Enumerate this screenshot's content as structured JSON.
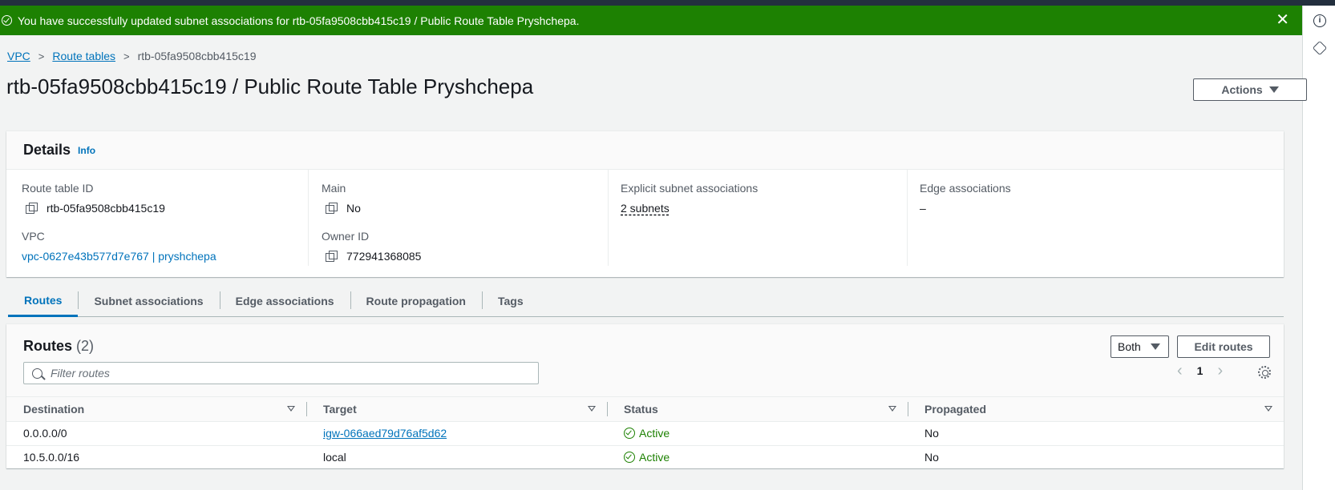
{
  "flash": {
    "message": "You have successfully updated subnet associations for rtb-05fa9508cbb415c19 / Public Route Table Pryshchepa.",
    "close": "✕"
  },
  "breadcrumb": [
    "VPC",
    "Route tables",
    "rtb-05fa9508cbb415c19"
  ],
  "page_title": "rtb-05fa9508cbb415c19 / Public Route Table Pryshchepa",
  "actions_label": "Actions",
  "details": {
    "heading": "Details",
    "info": "Info",
    "route_table_id_label": "Route table ID",
    "route_table_id": "rtb-05fa9508cbb415c19",
    "vpc_label": "VPC",
    "vpc": "vpc-0627e43b577d7e767 | pryshchepa",
    "main_label": "Main",
    "main": "No",
    "owner_label": "Owner ID",
    "owner": "772941368085",
    "explicit_label": "Explicit subnet associations",
    "explicit": "2 subnets",
    "edge_label": "Edge associations",
    "edge": "–"
  },
  "tabs": [
    "Routes",
    "Subnet associations",
    "Edge associations",
    "Route propagation",
    "Tags"
  ],
  "routes": {
    "heading": "Routes",
    "count": "(2)",
    "filter_value": "Both",
    "edit_label": "Edit routes",
    "search_placeholder": "Filter routes",
    "page": "1",
    "prev": "‹",
    "next": "›",
    "columns": [
      "Destination",
      "Target",
      "Status",
      "Propagated"
    ],
    "rows": [
      {
        "destination": "0.0.0.0/0",
        "target": "igw-066aed79d76af5d62",
        "status": "Active",
        "propagated": "No"
      },
      {
        "destination": "10.5.0.0/16",
        "target": "local",
        "status": "Active",
        "propagated": "No"
      }
    ]
  },
  "rail": {
    "info_icon": "i"
  },
  "colors": {
    "success": "#1d8102",
    "link": "#0073bb",
    "nav": "#232f3e"
  }
}
